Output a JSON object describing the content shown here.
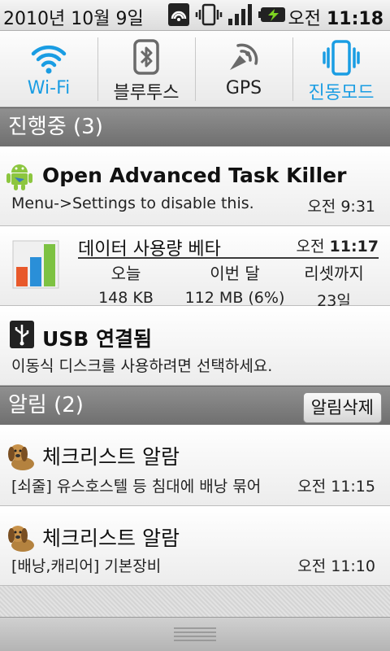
{
  "status_bar": {
    "date": "2010년 10월 9일",
    "time_prefix": "오전",
    "time": "11:18",
    "icons": [
      "sync-icon",
      "vibrate-icon",
      "signal-icon",
      "battery-charging-icon"
    ]
  },
  "toggles": [
    {
      "label": "Wi-Fi",
      "icon": "wifi-icon",
      "active": true
    },
    {
      "label": "블루투스",
      "icon": "bluetooth-icon",
      "active": false
    },
    {
      "label": "GPS",
      "icon": "gps-icon",
      "active": false
    },
    {
      "label": "진동모드",
      "icon": "vibrate-icon",
      "active": true
    }
  ],
  "ongoing": {
    "header": "진행중 (3)",
    "task_killer": {
      "title": "Open Advanced Task Killer",
      "text": "Menu->Settings to disable this.",
      "time": "오전 9:31"
    },
    "data_usage": {
      "title": "데이터 사용량 베타",
      "time_prefix": "오전",
      "time": "11:17",
      "columns": [
        {
          "header": "오늘",
          "value": "148 KB"
        },
        {
          "header": "이번 달",
          "value": "112 MB (6%)"
        },
        {
          "header": "리셋까지",
          "value": "23일"
        }
      ]
    },
    "usb": {
      "title": "USB 연결됨",
      "text": "이동식 디스크를 사용하려면 선택하세요."
    }
  },
  "notifications": {
    "header": "알림 (2)",
    "clear_label": "알림삭제",
    "items": [
      {
        "title": "체크리스트 알람",
        "text": "[쇠줄] 유스호스텔 등 침대에 배낭 묶어",
        "time": "오전 11:15"
      },
      {
        "title": "체크리스트 알람",
        "text": "[배낭,캐리어] 기본장비",
        "time": "오전 11:10"
      }
    ]
  },
  "colors": {
    "accent": "#1a9de3",
    "section_header": "#7d7d7d"
  }
}
